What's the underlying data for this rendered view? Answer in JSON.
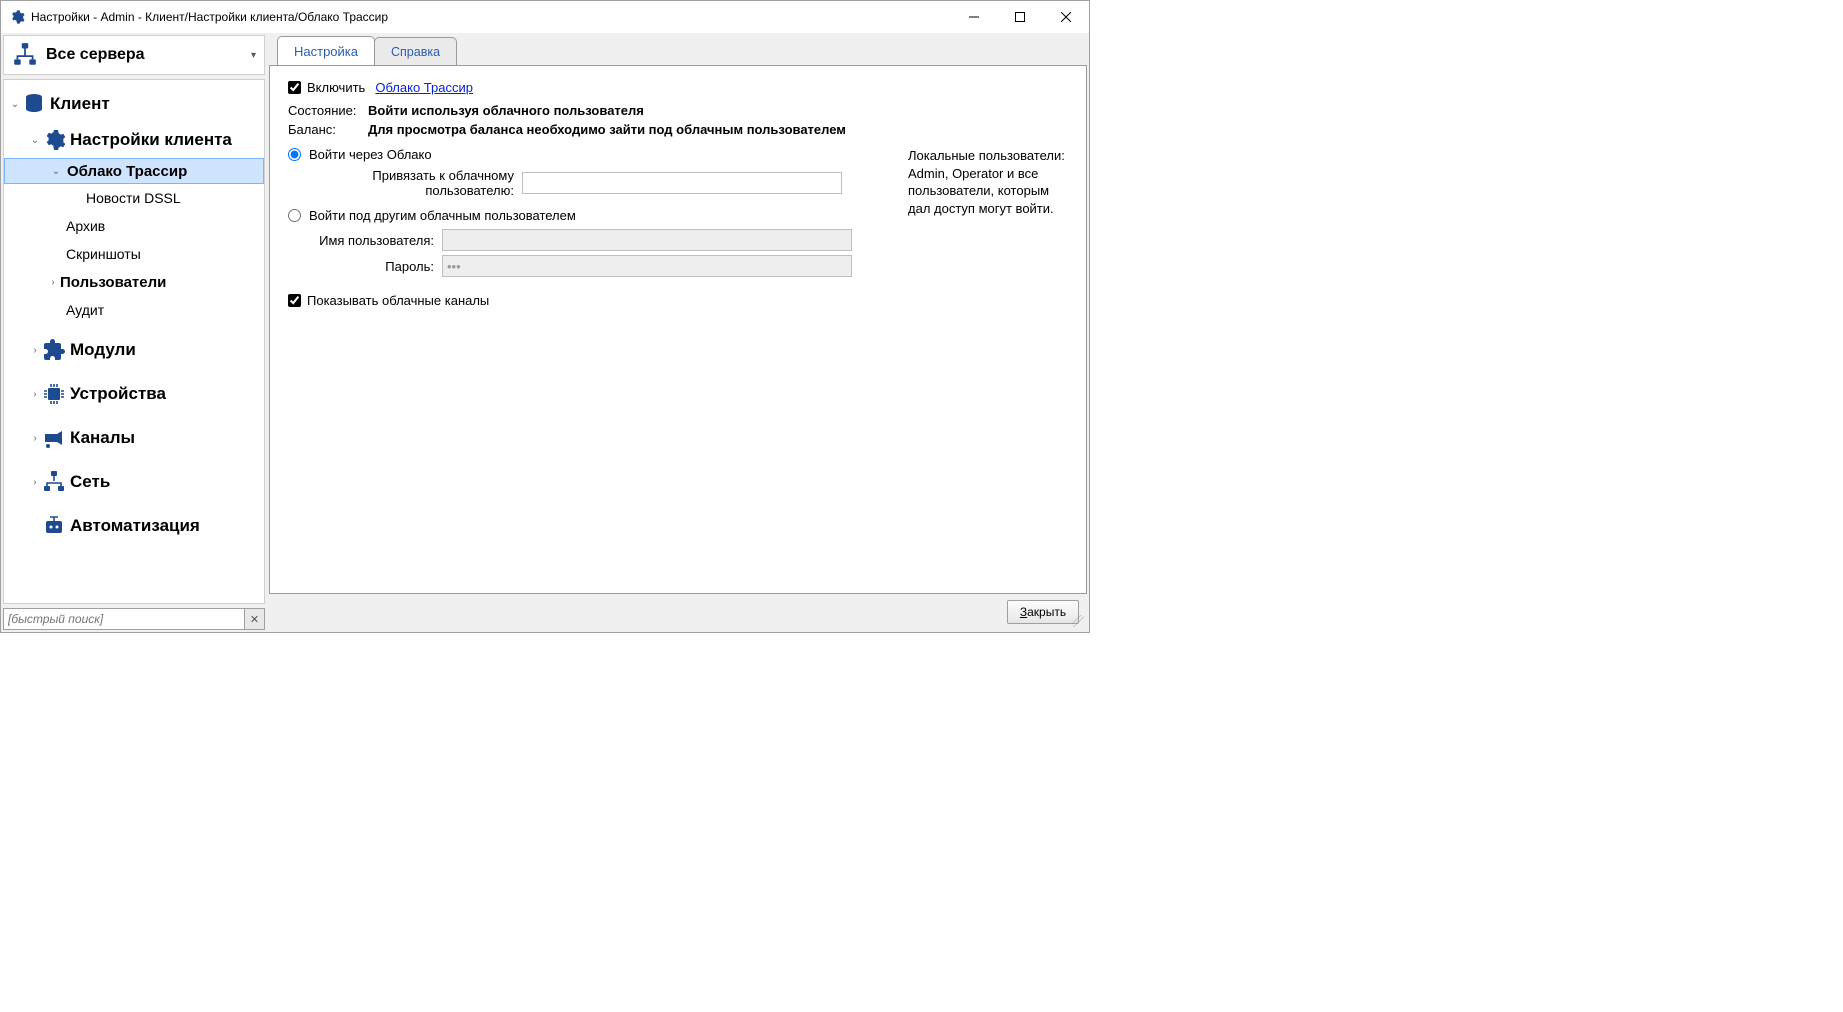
{
  "titlebar": {
    "title": "Настройки - Admin - Клиент/Настройки клиента/Облако Трассир"
  },
  "server_selector": {
    "label": "Все сервера"
  },
  "tree": {
    "client": "Клиент",
    "client_settings": "Настройки клиента",
    "cloud_trassir": "Облако Трассир",
    "news_dssl": "Новости DSSL",
    "archive": "Архив",
    "screenshots": "Скриншоты",
    "users": "Пользователи",
    "audit": "Аудит",
    "modules": "Модули",
    "devices": "Устройства",
    "channels": "Каналы",
    "network": "Сеть",
    "automation": "Автоматизация"
  },
  "quicksearch": {
    "placeholder": "[быстрый поиск]"
  },
  "tabs": {
    "settings": "Настройка",
    "help": "Справка"
  },
  "form": {
    "enable": "Включить",
    "cloud_link": "Облако Трассир",
    "state_label": "Состояние:",
    "state_value": "Войти используя облачного пользователя",
    "balance_label": "Баланс:",
    "balance_value": "Для просмотра баланса необходимо зайти под облачным пользователем",
    "login_cloud": "Войти через Облако",
    "bind_cloud_user": "Привязать к облачному пользователю:",
    "bind_value": "",
    "login_other": "Войти под другим облачным пользователем",
    "username_label": "Имя пользователя:",
    "username_value": "",
    "password_label": "Пароль:",
    "password_value": "",
    "show_cloud_channels": "Показывать облачные каналы",
    "right_note": "Локальные пользователи: Admin, Operator и все пользователи, которым дал доступ могут войти."
  },
  "footer": {
    "close": "Закрыть"
  }
}
